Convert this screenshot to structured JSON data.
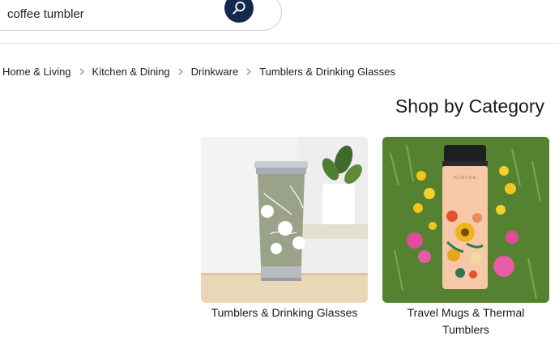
{
  "search": {
    "query": "coffee tumbler",
    "button_icon": "search-icon",
    "button_color": "#14294f"
  },
  "breadcrumb": {
    "items": [
      "Home & Living",
      "Kitchen & Dining",
      "Drinkware",
      "Tumblers & Drinking Glasses"
    ],
    "separator_icon": "chevron-right-icon"
  },
  "shop_by_category": {
    "title": "Shop by Category",
    "categories": [
      {
        "label": "Tumblers & Drinking Glasses",
        "image_icon": "floral-tumbler-photo"
      },
      {
        "label": "Travel Mugs & Thermal Tumblers",
        "image_icon": "travel-mug-photo",
        "image_text": "WINTER"
      }
    ]
  }
}
